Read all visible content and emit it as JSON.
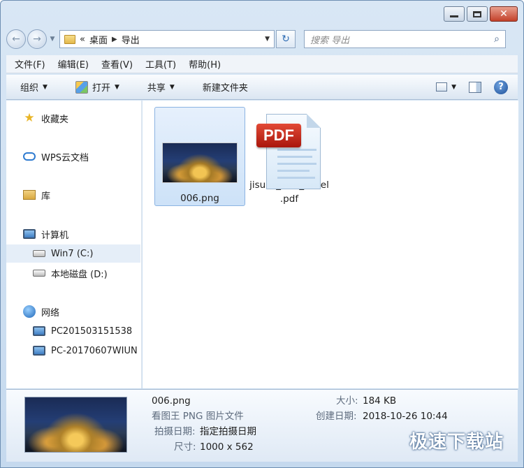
{
  "address": {
    "back_arrow": "←",
    "forward_arrow": "→",
    "prefix": "«",
    "crumbs": [
      "桌面",
      "导出"
    ],
    "refresh_glyph": "↻",
    "search_placeholder": "搜索 导出"
  },
  "menubar": [
    "文件(F)",
    "编辑(E)",
    "查看(V)",
    "工具(T)",
    "帮助(H)"
  ],
  "commandbar": {
    "organize": "组织",
    "open": "打开",
    "share": "共享",
    "new_folder": "新建文件夹",
    "help_glyph": "?"
  },
  "nav": {
    "favorites": "收藏夹",
    "wps": "WPS云文档",
    "library": "库",
    "computer": "计算机",
    "drive_c": "Win7 (C:)",
    "drive_d": "本地磁盘 (D:)",
    "network": "网络",
    "pc1": "PC201503151538",
    "pc2": "PC-20170607WIUN"
  },
  "files": [
    {
      "name": "006.png",
      "selected": true
    },
    {
      "name_line1": "jisuxz_PDF_Excel",
      "name_line2": ".pdf",
      "badge": "PDF",
      "selected": false
    }
  ],
  "details": {
    "filename": "006.png",
    "filetype": "看图王 PNG 图片文件",
    "date_taken_label": "拍摄日期:",
    "date_taken_value": "指定拍摄日期",
    "dimensions_label": "尺寸:",
    "dimensions_value": "1000 x 562",
    "size_label": "大小:",
    "size_value": "184 KB",
    "created_label": "创建日期:",
    "created_value": "2018-10-26 10:44"
  },
  "watermark": "极速下载站",
  "colors": {
    "accent": "#2f6db4",
    "selection": "#cde2f8",
    "window_frame": "#c5d9ee"
  }
}
